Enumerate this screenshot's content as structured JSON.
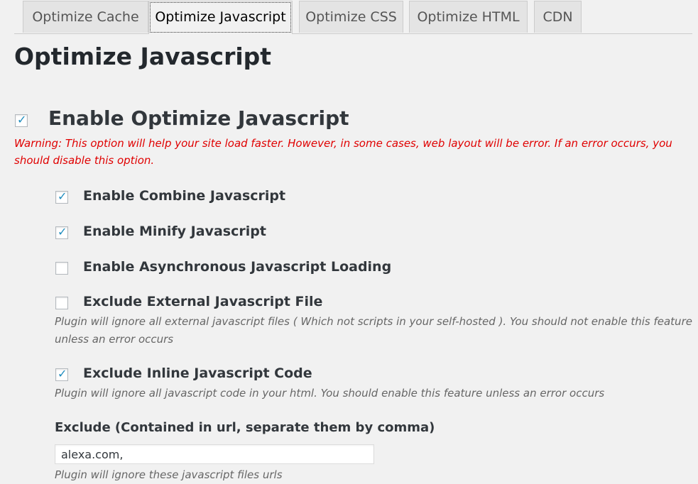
{
  "tabs": [
    {
      "label": "Optimize Cache",
      "active": false
    },
    {
      "label": "Optimize Javascript",
      "active": true
    },
    {
      "label": "Optimize CSS",
      "active": false
    },
    {
      "label": "Optimize HTML",
      "active": false
    },
    {
      "label": "CDN",
      "active": false
    }
  ],
  "page": {
    "title": "Optimize Javascript"
  },
  "main_option": {
    "label": "Enable Optimize Javascript",
    "checked": true,
    "warning": "Warning: This option will help your site load faster. However, in some cases, web layout will be error. If an error occurs, you should disable this option."
  },
  "options": [
    {
      "label": "Enable Combine Javascript",
      "checked": true
    },
    {
      "label": "Enable Minify Javascript",
      "checked": true
    },
    {
      "label": "Enable Asynchronous Javascript Loading",
      "checked": false
    },
    {
      "label": "Exclude External Javascript File",
      "checked": false,
      "description": "Plugin will ignore all external javascript files ( Which not scripts in your self-hosted ). You should not enable this feature unless an error occurs"
    },
    {
      "label": "Exclude Inline Javascript Code",
      "checked": true,
      "description": "Plugin will ignore all javascript code in your html. You should enable this feature unless an error occurs"
    }
  ],
  "exclude_field": {
    "label": "Exclude (Contained in url, separate them by comma)",
    "value": "alexa.com,",
    "description": "Plugin will ignore these javascript files urls"
  },
  "colors": {
    "warning": "#e00000",
    "checkmark": "#1e8cbe",
    "background": "#f1f1f1"
  }
}
